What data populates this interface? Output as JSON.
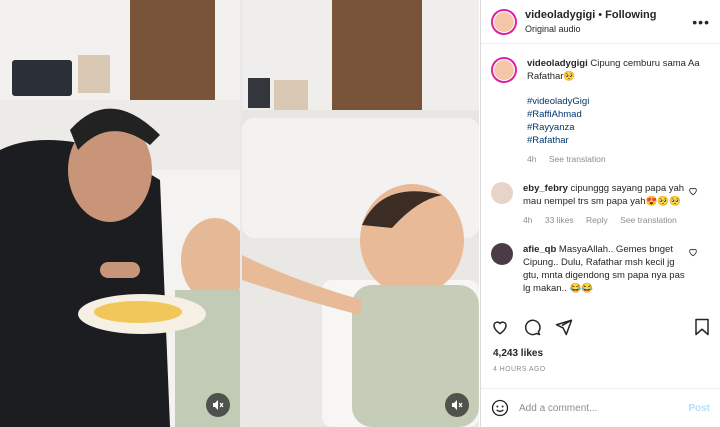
{
  "header": {
    "username": "videoladygigi",
    "separator": "•",
    "following_label": "Following",
    "audio_label": "Original audio"
  },
  "caption": {
    "username": "videoladygigi",
    "text": "Cipung cemburu sama Aa Rafathar🥺",
    "hashtags": [
      "#videoladyGigi",
      "#RaffiAhmad",
      "#Rayyanza",
      "#Rafathar"
    ],
    "time": "4h",
    "see_translation": "See translation"
  },
  "comments": [
    {
      "username": "eby_febry",
      "text": "cipunggg sayang papa yah mau nempel trs sm papa yah😍🥺🥺",
      "time": "4h",
      "likes": "33 likes",
      "reply": "Reply",
      "see_translation": "See translation"
    },
    {
      "username": "afie_qb",
      "text": "MasyaAllah.. Gemes bnget Cipung.. Dulu, Rafathar msh kecil jg gtu, mnta digendong sm papa nya pas lg makan.. 😂😂"
    }
  ],
  "likes_count": "4,243 likes",
  "posted_ago": "4 HOURS AGO",
  "add_comment": {
    "placeholder": "Add a comment...",
    "post_label": "Post"
  },
  "colors": {
    "link": "#00376b",
    "muted": "#8e8e8e",
    "post_disabled": "#b2dffc",
    "story_ring": "#d6249f"
  },
  "icons": [
    "more-icon",
    "heart-icon",
    "comment-icon",
    "share-icon",
    "bookmark-icon",
    "emoji-icon",
    "mute-icon"
  ]
}
